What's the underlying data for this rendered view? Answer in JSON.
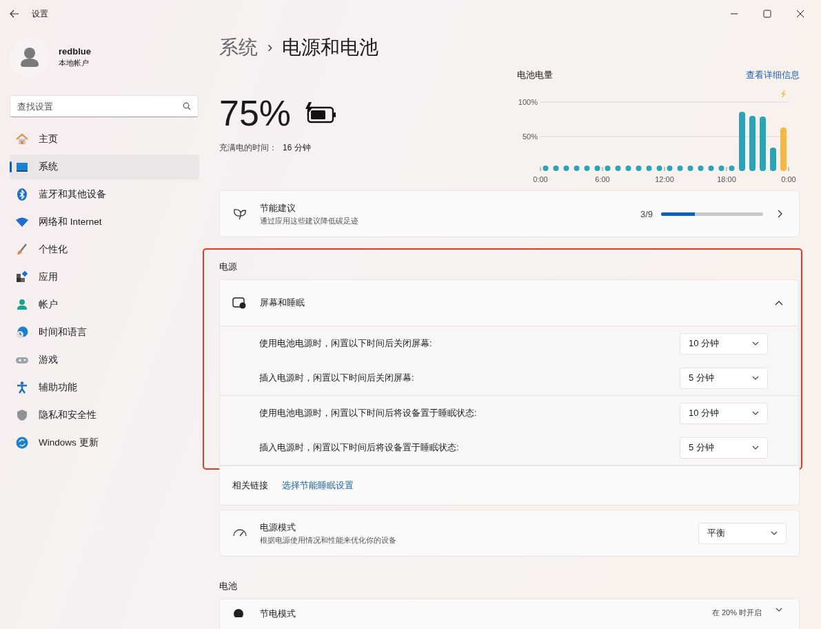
{
  "window": {
    "title": "设置"
  },
  "account": {
    "name": "redblue",
    "type": "本地帐户"
  },
  "search": {
    "placeholder": "查找设置"
  },
  "nav": [
    {
      "label": "主页",
      "selected": false
    },
    {
      "label": "系统",
      "selected": true
    },
    {
      "label": "蓝牙和其他设备",
      "selected": false
    },
    {
      "label": "网络和 Internet",
      "selected": false
    },
    {
      "label": "个性化",
      "selected": false
    },
    {
      "label": "应用",
      "selected": false
    },
    {
      "label": "帐户",
      "selected": false
    },
    {
      "label": "时间和语言",
      "selected": false
    },
    {
      "label": "游戏",
      "selected": false
    },
    {
      "label": "辅助功能",
      "selected": false
    },
    {
      "label": "隐私和安全性",
      "selected": false
    },
    {
      "label": "Windows 更新",
      "selected": false
    }
  ],
  "breadcrumb": {
    "parent": "系统",
    "separator": "›",
    "current": "电源和电池"
  },
  "battery": {
    "percent": "75%",
    "charging": true,
    "time_label": "充满电的时间：",
    "time_value": "16 分钟"
  },
  "usage": {
    "link": "查看详细信息",
    "chart_data": {
      "type": "bar",
      "title": "电池电量",
      "x": [
        19.5,
        20.5,
        21.5,
        22.5,
        23.5
      ],
      "series": [
        {
          "color": "#2aa5b8",
          "values": [
            86,
            80,
            79,
            34,
            null
          ]
        },
        {
          "color": "#f5b942",
          "values": [
            null,
            null,
            null,
            null,
            63
          ]
        }
      ],
      "xlim": [
        0,
        24
      ],
      "ylim": [
        0,
        100
      ],
      "xticks": [
        {
          "value": 0,
          "label": "0:00"
        },
        {
          "value": 6,
          "label": "6:00"
        },
        {
          "value": 12,
          "label": "12:00"
        },
        {
          "value": 18,
          "label": "18:00"
        },
        {
          "value": 24,
          "label": "0:00"
        }
      ],
      "yticks": [
        {
          "value": 50,
          "label": "50%"
        },
        {
          "value": 100,
          "label": "100%"
        }
      ]
    }
  },
  "recommendations": {
    "title": "节能建议",
    "subtitle": "通过应用这些建议降低碳足迹",
    "count": "3/9",
    "level": 0.33
  },
  "power": {
    "heading": "电源",
    "highlighted": true,
    "screen_sleep": {
      "title": "屏幕和睡眠",
      "expanded": true,
      "groups": [
        {
          "rows": [
            {
              "label": "使用电池电源时，闲置以下时间后关闭屏幕:",
              "value": "10 分钟"
            },
            {
              "label": "插入电源时，闲置以下时间后关闭屏幕:",
              "value": "5 分钟"
            }
          ]
        },
        {
          "rows": [
            {
              "label": "使用电池电源时，闲置以下时间后将设备置于睡眠状态:",
              "value": "10 分钟"
            },
            {
              "label": "插入电源时，闲置以下时间后将设备置于睡眠状态:",
              "value": "5 分钟"
            }
          ]
        }
      ]
    },
    "related_label": "相关链接",
    "related_link": "选择节能睡眠设置",
    "mode": {
      "title": "电源模式",
      "subtitle": "根据电源使用情况和性能来优化你的设备",
      "value": "平衡"
    }
  },
  "battery_section": {
    "heading": "电池",
    "saver": {
      "title": "节电模式",
      "value": "在 20% 时开启"
    }
  }
}
